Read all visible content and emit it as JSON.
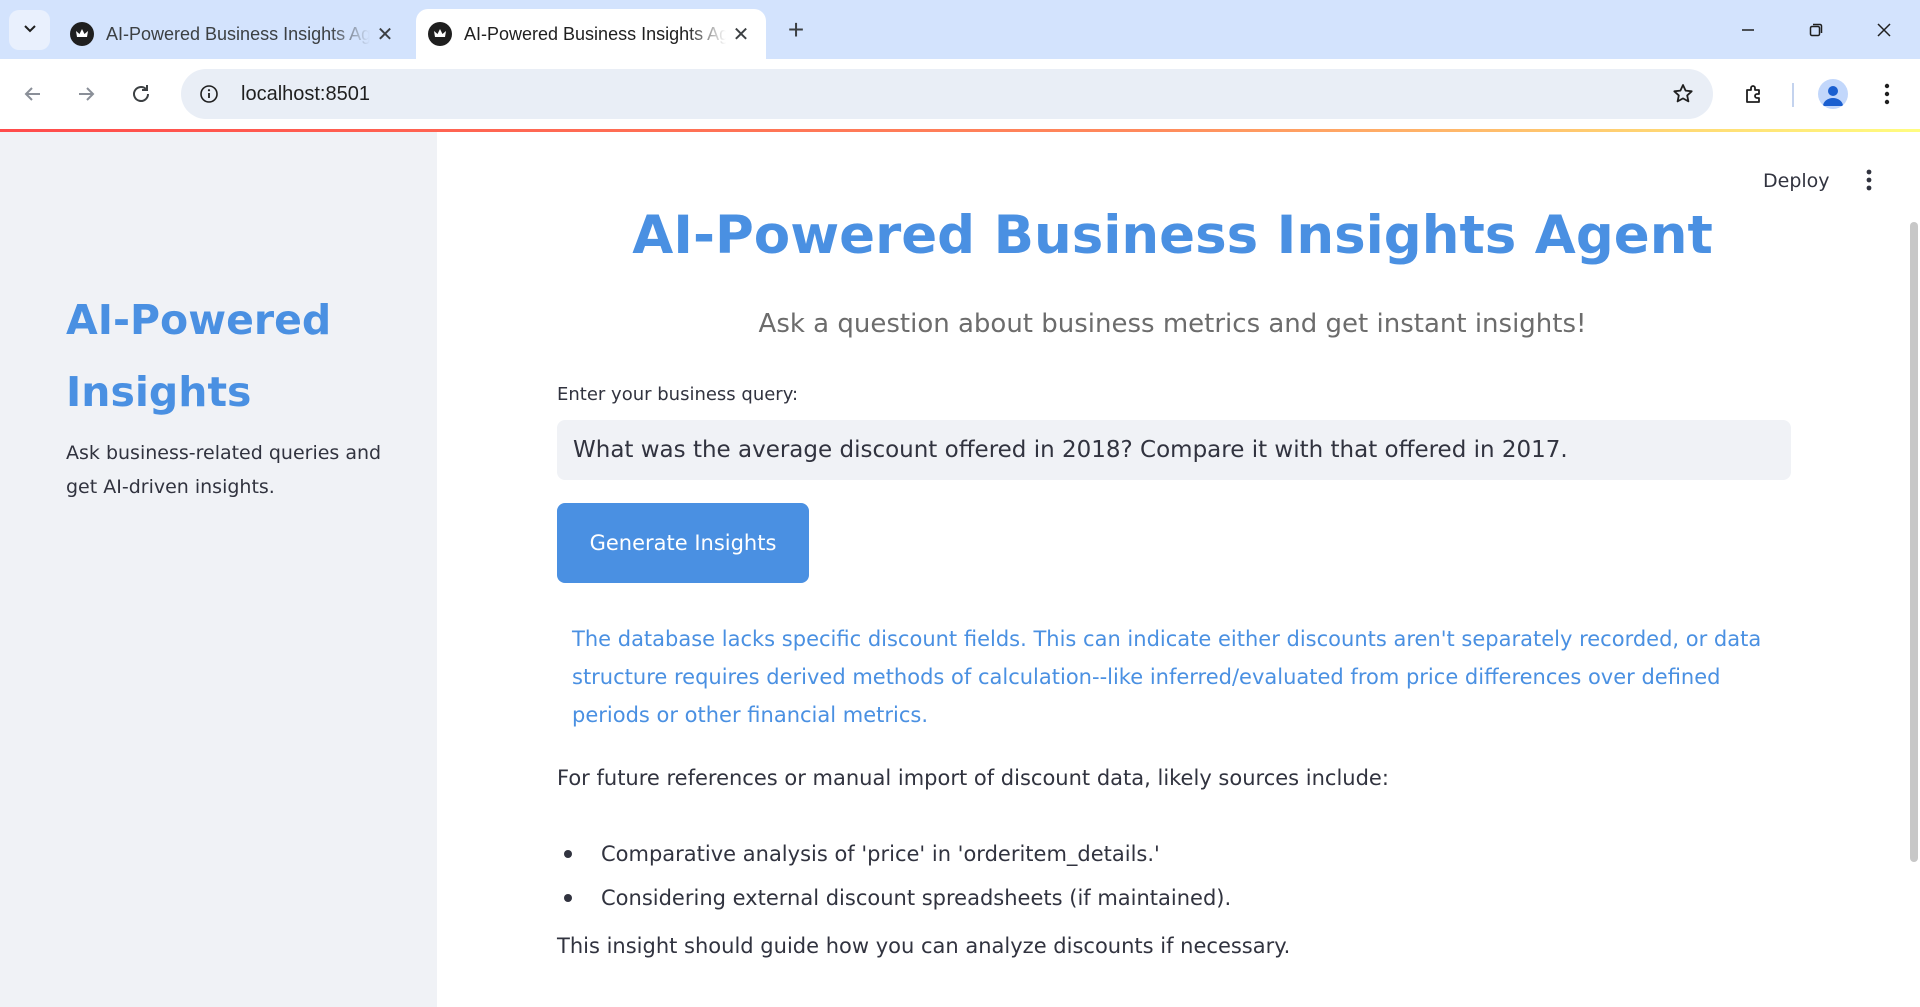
{
  "browser": {
    "tabs": [
      {
        "title": "AI-Powered Business Insights Agent",
        "active": false
      },
      {
        "title": "AI-Powered Business Insights Agent",
        "active": true
      }
    ],
    "url": "localhost:8501"
  },
  "sidebar": {
    "title": "AI-Powered Insights",
    "description": "Ask business-related queries and get AI-driven insights."
  },
  "header": {
    "deploy_label": "Deploy"
  },
  "main": {
    "title": "AI-Powered Business Insights Agent",
    "subtitle": "Ask a question about business metrics and get instant insights!",
    "query_label": "Enter your business query:",
    "query_value": "What was the average discount offered in 2018? Compare it with that offered in 2017.",
    "button_label": "Generate Insights",
    "insight_text": "The database lacks specific discount fields. This can indicate either discounts aren't separately recorded, or data structure requires derived methods of calculation--like inferred/evaluated from price differences over defined periods or other financial metrics.",
    "sources_intro": "For future references or manual import of discount data, likely sources include:",
    "sources": [
      "Comparative analysis of 'price' in 'orderitem_details.'",
      "Considering external discount spreadsheets (if maintained)."
    ],
    "closing": "This insight should guide how you can analyze discounts if necessary."
  },
  "colors": {
    "accent": "#4a90e2",
    "sidebar_bg": "#f0f2f6",
    "text": "#31333f",
    "chrome_tabbar": "#d3e3fd"
  },
  "icons": [
    "tab-search-icon",
    "favicon-icon",
    "close-icon",
    "new-tab-icon",
    "minimize-icon",
    "restore-icon",
    "window-close-icon",
    "back-icon",
    "forward-icon",
    "reload-icon",
    "site-info-icon",
    "bookmark-star-icon",
    "extensions-icon",
    "profile-icon",
    "chrome-menu-icon",
    "app-menu-icon"
  ]
}
